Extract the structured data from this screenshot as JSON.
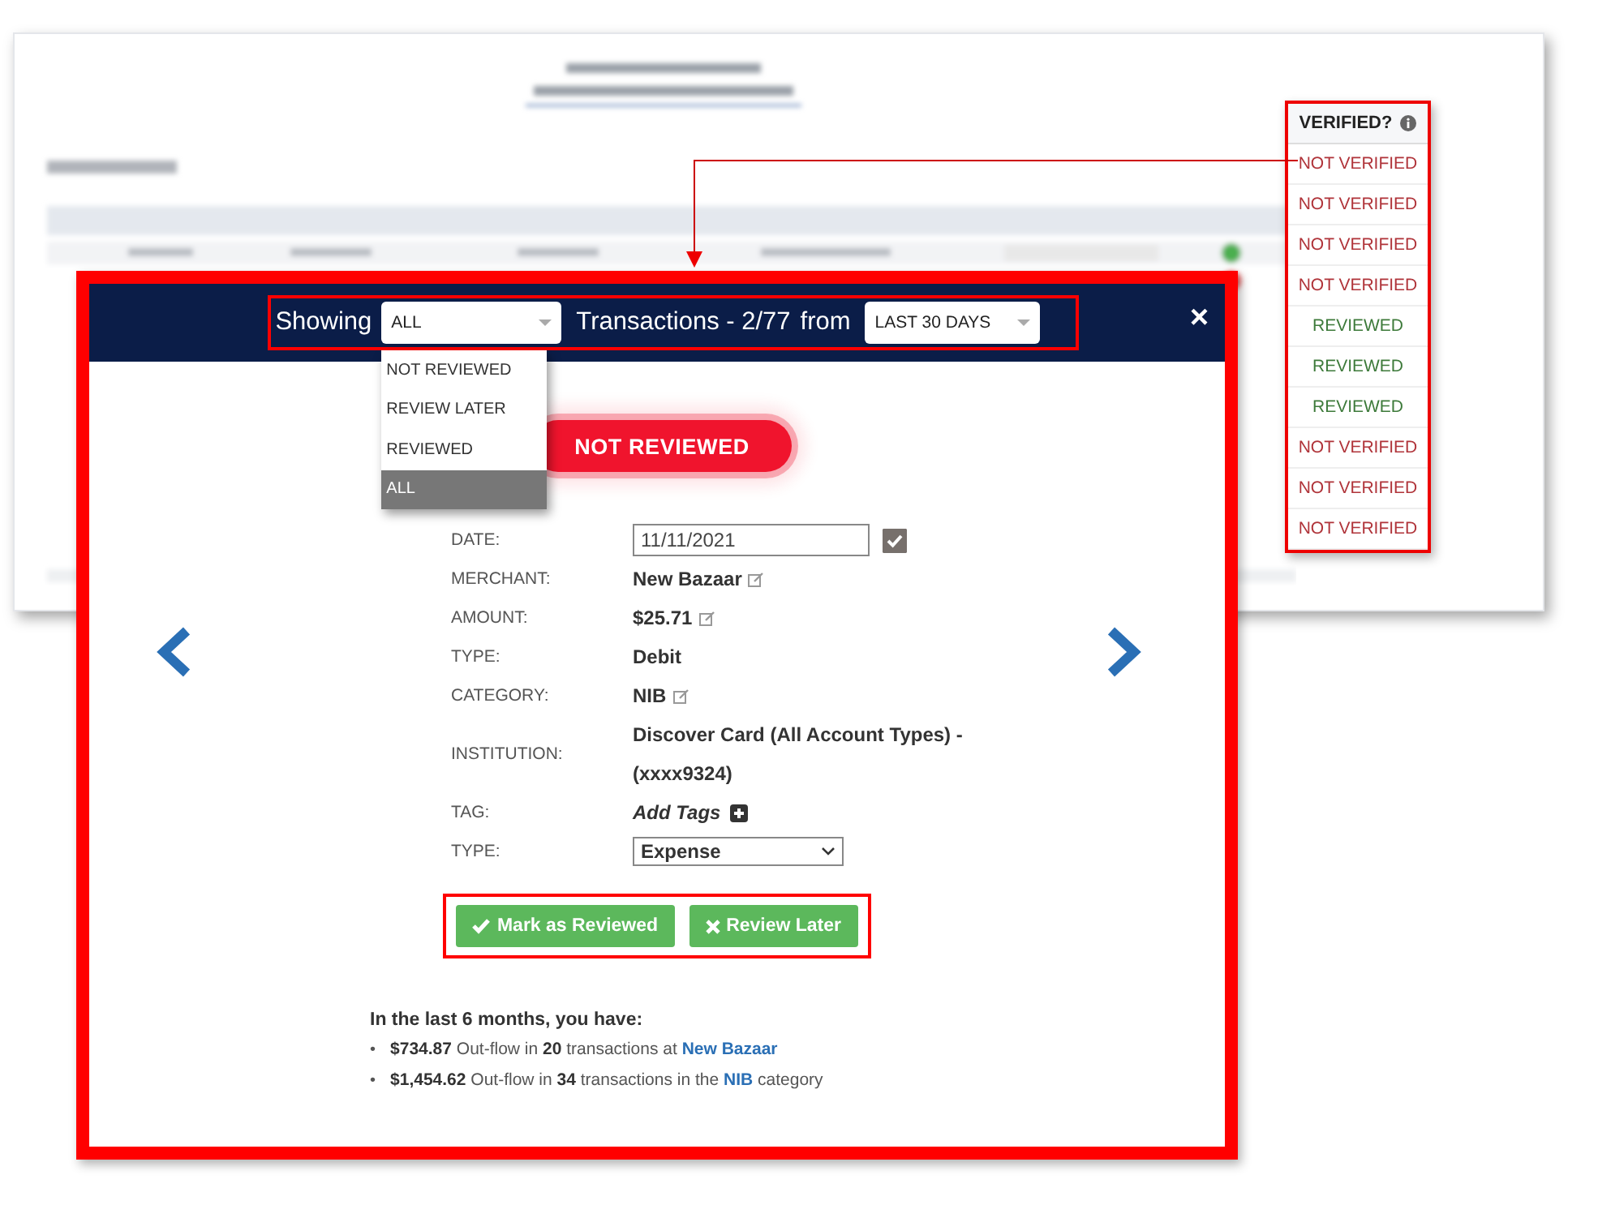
{
  "verified_column": {
    "header": "VERIFIED?",
    "rows": [
      {
        "label": "NOT VERIFIED",
        "color": "#b0343a"
      },
      {
        "label": "NOT VERIFIED",
        "color": "#b0343a"
      },
      {
        "label": "NOT VERIFIED",
        "color": "#b0343a"
      },
      {
        "label": "NOT VERIFIED",
        "color": "#b0343a"
      },
      {
        "label": "REVIEWED",
        "color": "#3d7a3a"
      },
      {
        "label": "REVIEWED",
        "color": "#3d7a3a"
      },
      {
        "label": "REVIEWED",
        "color": "#3d7a3a"
      },
      {
        "label": "NOT VERIFIED",
        "color": "#b0343a"
      },
      {
        "label": "NOT VERIFIED",
        "color": "#b0343a"
      },
      {
        "label": "NOT VERIFIED",
        "color": "#b0343a"
      }
    ]
  },
  "modal": {
    "header": {
      "showing_label": "Showing",
      "filter_value": "ALL",
      "middle_text": "Transactions - 2/77",
      "from_label": "from",
      "range_value": "LAST 30 DAYS",
      "close": "×"
    },
    "filter_options": [
      {
        "label": "NOT REVIEWED",
        "selected": false
      },
      {
        "label": "REVIEW LATER",
        "selected": false
      },
      {
        "label": "REVIEWED",
        "selected": false
      },
      {
        "label": "ALL",
        "selected": true
      }
    ],
    "status_badge": "NOT REVIEWED",
    "fields": [
      {
        "label": "DATE:",
        "kind": "date",
        "value": "11/11/2021",
        "checked": true
      },
      {
        "label": "MERCHANT:",
        "kind": "editable",
        "value": "New Bazaar"
      },
      {
        "label": "AMOUNT:",
        "kind": "editable",
        "value": "$25.71"
      },
      {
        "label": "TYPE:",
        "kind": "text",
        "value": "Debit"
      },
      {
        "label": "CATEGORY:",
        "kind": "editable",
        "value": "NIB"
      },
      {
        "label": "INSTITUTION:",
        "kind": "text",
        "value": "Discover Card (All Account Types) - (xxxx9324)"
      },
      {
        "label": "TAG:",
        "kind": "tag",
        "value": "Add Tags"
      },
      {
        "label": "TYPE:",
        "kind": "select",
        "value": "Expense"
      }
    ],
    "buttons": [
      {
        "label": "Mark as Reviewed",
        "kind": "check"
      },
      {
        "label": "Review Later",
        "kind": "cross"
      }
    ],
    "summary": {
      "heading": "In the last 6 months, you have:",
      "items": [
        {
          "bullet": "•",
          "text": "**$734.87** Out-flow in **20** transactions at ",
          "link": "New Bazaar"
        },
        {
          "bullet": "•",
          "text": "**$1,454.62** Out-flow in **34** transactions in the ",
          "link": "NIB",
          "after": " category"
        }
      ]
    }
  }
}
